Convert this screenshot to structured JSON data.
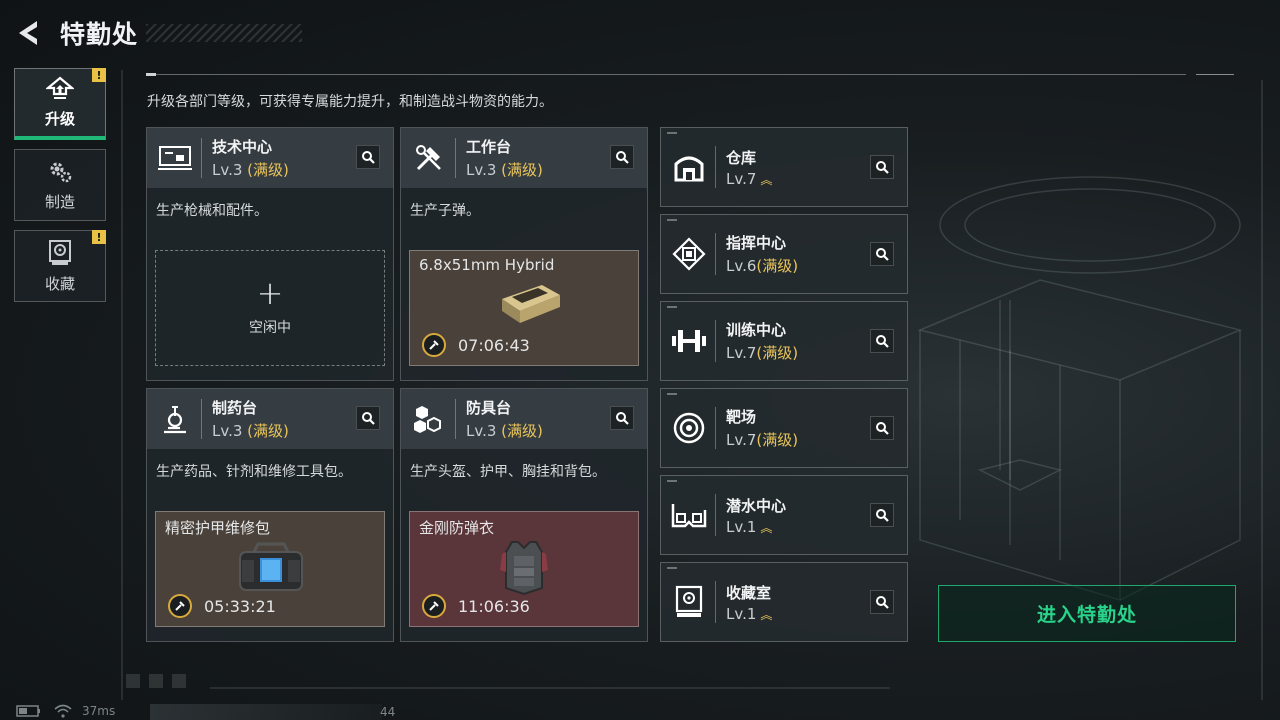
{
  "header": {
    "title": "特勤处"
  },
  "nav": {
    "items": [
      {
        "label": "升级",
        "icon": "upgrade-icon",
        "active": true,
        "alert": "!"
      },
      {
        "label": "制造",
        "icon": "gears-icon",
        "active": false
      },
      {
        "label": "收藏",
        "icon": "collection-icon",
        "active": false,
        "alert": "!"
      }
    ]
  },
  "description": "升级各部门等级，可获得专属能力提升，和制造战斗物资的能力。",
  "cards": [
    {
      "name": "技术中心",
      "level": "Lv.3",
      "max": "(满级)",
      "icon": "tech-center-icon",
      "desc": "生产枪械和配件。",
      "slot": {
        "type": "idle",
        "plus": "+",
        "label": "空闲中"
      }
    },
    {
      "name": "工作台",
      "level": "Lv.3",
      "max": "(满级)",
      "icon": "workbench-icon",
      "desc": "生产子弹。",
      "slot": {
        "type": "producing",
        "item": "6.8x51mm Hybrid",
        "timer": "07:06:43"
      }
    },
    {
      "name": "制药台",
      "level": "Lv.3",
      "max": "(满级)",
      "icon": "pharmacy-icon",
      "desc": "生产药品、针剂和维修工具包。",
      "slot": {
        "type": "producing",
        "item": "精密护甲维修包",
        "timer": "05:33:21"
      }
    },
    {
      "name": "防具台",
      "level": "Lv.3",
      "max": "(满级)",
      "icon": "armor-bench-icon",
      "desc": "生产头盔、护甲、胸挂和背包。",
      "slot": {
        "type": "producing",
        "item": "金刚防弹衣",
        "timer": "11:06:36"
      }
    }
  ],
  "small_cards": [
    {
      "name": "仓库",
      "level": "Lv.7",
      "suffix": "",
      "upgradable": true,
      "icon": "warehouse-icon"
    },
    {
      "name": "指挥中心",
      "level": "Lv.6",
      "suffix": "(满级)",
      "upgradable": false,
      "icon": "command-center-icon"
    },
    {
      "name": "训练中心",
      "level": "Lv.7",
      "suffix": "(满级)",
      "upgradable": false,
      "icon": "training-center-icon"
    },
    {
      "name": "靶场",
      "level": "Lv.7",
      "suffix": "(满级)",
      "upgradable": false,
      "icon": "range-target-icon"
    },
    {
      "name": "潜水中心",
      "level": "Lv.1",
      "suffix": "",
      "upgradable": true,
      "icon": "diving-center-icon"
    },
    {
      "name": "收藏室",
      "level": "Lv.1",
      "suffix": "",
      "upgradable": true,
      "icon": "collection-room-icon"
    }
  ],
  "enter_button": {
    "label": "进入特勤处"
  },
  "status": {
    "ping": "37ms",
    "number": "44"
  },
  "colors": {
    "accent": "#29d38b",
    "max_level": "#e8c45a",
    "alert": "#e9c145"
  }
}
